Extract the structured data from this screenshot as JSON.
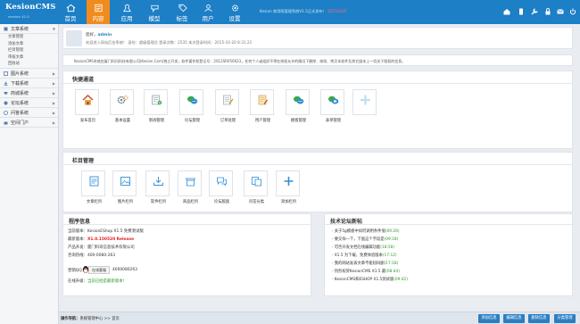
{
  "app": {
    "title": "KesionCMS",
    "version": "version X1.5"
  },
  "nav": [
    {
      "label": "首页",
      "icon": "home-icon"
    },
    {
      "label": "内容",
      "icon": "content-icon",
      "active": true
    },
    {
      "label": "应用",
      "icon": "apps-icon"
    },
    {
      "label": "模型",
      "icon": "model-icon"
    },
    {
      "label": "标签",
      "icon": "tag-icon"
    },
    {
      "label": "用户",
      "icon": "user-icon"
    },
    {
      "label": "设置",
      "icon": "settings-icon"
    }
  ],
  "top_info": {
    "text": "Kesion 商用版管理系统V1.5正式发布！",
    "date": "2015/4/25"
  },
  "top_icons": [
    "home-icon",
    "mobile-icon",
    "tools-icon",
    "lock-icon",
    "mail-icon",
    "power-icon"
  ],
  "sidebar": {
    "groups": [
      {
        "label": "文章系统",
        "icon": "article-icon",
        "expanded": true,
        "items": [
          "文章管理",
          "添加文章",
          "栏目管理",
          "审核文章",
          "回收站"
        ]
      },
      {
        "label": "图片系统",
        "icon": "image-icon"
      },
      {
        "label": "下载系统",
        "icon": "download-icon"
      },
      {
        "label": "商城系统",
        "icon": "shop-icon"
      },
      {
        "label": "论坛系统",
        "icon": "forum-icon"
      },
      {
        "label": "问答系统",
        "icon": "qa-icon"
      },
      {
        "label": "空间门户",
        "icon": "space-icon"
      }
    ]
  },
  "welcome": {
    "greeting": "您好，",
    "username": "admin",
    "line2": "欢迎进入网站后台系统！ 身份：超级管理员 登录次数：2535 本次登录时间：2015-10-20 8:31:21"
  },
  "notice": "KesionCMS系统由厦门科讯科技有限公司(Kesion.Com)独立开发，软件著作权登记号：2012SR050623，任何个人或组织不得在授权允许的情况下删除、修改、拷贝本软件及其它副本上一切关于版权的信息。",
  "quick": {
    "title": "快捷通道",
    "tiles": [
      {
        "label": "发布首页",
        "icon": "home-publish-icon"
      },
      {
        "label": "基本设置",
        "icon": "basic-settings-icon"
      },
      {
        "label": "新闻管理",
        "icon": "news-icon"
      },
      {
        "label": "论坛管理",
        "icon": "forum-manage-icon"
      },
      {
        "label": "订单处理",
        "icon": "order-icon"
      },
      {
        "label": "用户管理",
        "icon": "user-manage-icon"
      },
      {
        "label": "模板管理",
        "icon": "template-icon"
      },
      {
        "label": "表单管理",
        "icon": "form-icon"
      },
      {
        "label": "",
        "icon": "plus-icon"
      }
    ]
  },
  "catalog": {
    "title": "栏目管理",
    "tiles": [
      {
        "label": "文章栏目",
        "icon": "article-column-icon"
      },
      {
        "label": "图片栏目",
        "icon": "image-column-icon"
      },
      {
        "label": "软件栏目",
        "icon": "software-column-icon"
      },
      {
        "label": "商品栏目",
        "icon": "goods-column-icon"
      },
      {
        "label": "论坛版面",
        "icon": "forum-board-icon"
      },
      {
        "label": "问答分类",
        "icon": "qa-category-icon"
      },
      {
        "label": "添加栏目",
        "icon": "add-column-icon"
      }
    ]
  },
  "program": {
    "title": "程序信息",
    "current_version_label": "当前版本：",
    "current_version": "KesionEShop X1.5 免费测试版",
    "latest_version_label": "最新版本：",
    "latest_version": "X1.0.150520 Release",
    "developer_label": "产品开发：",
    "developer": "厦门科讯信息技术有限公司",
    "phone_label": "咨询热线：",
    "phone": "400-0080-263",
    "qq_label": "营销QQ：",
    "qq_button": "在线客服",
    "qq_number": "4000080263",
    "upgrade_label": "在线升级：",
    "upgrade_status": "当前已经是最新版本！"
  },
  "forum": {
    "title": "技术论坛新帖",
    "posts": [
      {
        "title": "关于5g模板中如何调用条件值",
        "date": "(09:26)"
      },
      {
        "title": "要交样一下，下面这个字段是",
        "date": "(09:18)"
      },
      {
        "title": "可否开发文档在线编辑功能",
        "date": "(18:58)"
      },
      {
        "title": "X1.5 为下载，免费体验版本",
        "date": "(17:12)"
      },
      {
        "title": "我的网站发表文章不能短码删",
        "date": "(17:18)"
      },
      {
        "title": "热烈祝贺KesionCMS X1.5 最",
        "date": "(08:44)"
      },
      {
        "title": "KesionCMS和ESHOP X1.5测试版",
        "date": "(09:42)"
      }
    ]
  },
  "bottom": {
    "crumb_label": "操作导航：",
    "crumb_path": "系统管理中心 >> 首页",
    "buttons": [
      "添加信息",
      "编辑信息",
      "删除信息",
      "分类管理"
    ]
  },
  "colors": {
    "topbar": "#1d7fc6",
    "active_nav": "#f28b1e",
    "accent": "#2b7ec3"
  }
}
